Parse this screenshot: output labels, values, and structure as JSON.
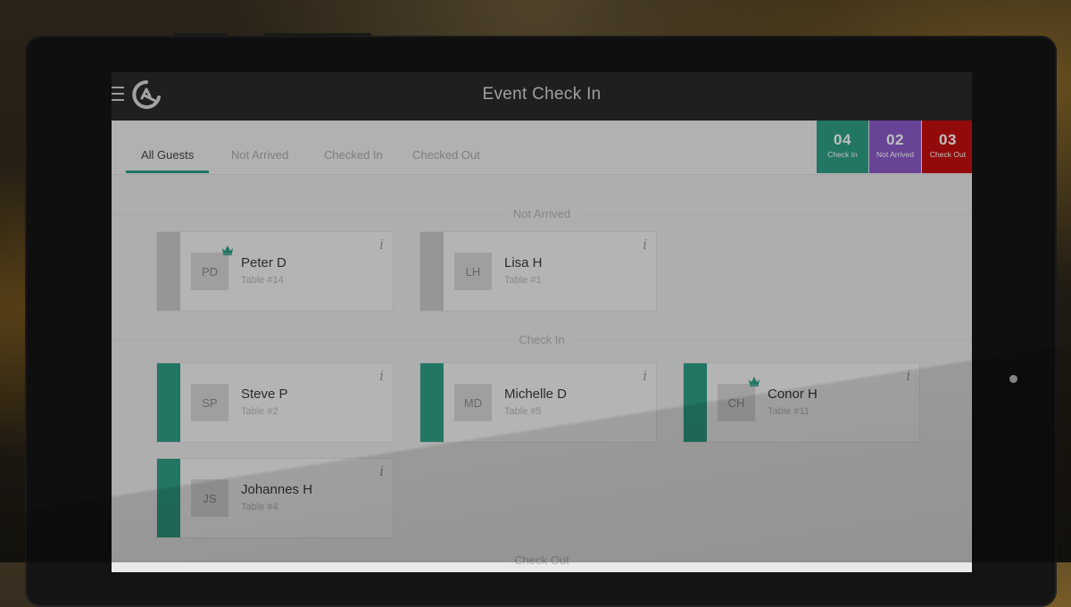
{
  "app": {
    "title": "Event Check In"
  },
  "tabs": [
    {
      "label": "All Guests",
      "active": true
    },
    {
      "label": "Not Arrived",
      "active": false
    },
    {
      "label": "Checked In",
      "active": false
    },
    {
      "label": "Checked Out",
      "active": false
    }
  ],
  "stats": [
    {
      "value": "04",
      "label": "Check In",
      "color": "#2e9e86"
    },
    {
      "value": "02",
      "label": "Not Arrived",
      "color": "#8a5bc9"
    },
    {
      "value": "03",
      "label": "Check Out",
      "color": "#c40e0e"
    }
  ],
  "sections": [
    {
      "label": "Not Arrived",
      "strip_color": "#c9c9c9",
      "guests": [
        {
          "initials": "PD",
          "name": "Peter D",
          "table": "Table #14",
          "vip": true
        },
        {
          "initials": "LH",
          "name": "Lisa H",
          "table": "Table #1",
          "vip": false
        }
      ]
    },
    {
      "label": "Check In",
      "strip_color": "#2e9e86",
      "guests": [
        {
          "initials": "SP",
          "name": "Steve P",
          "table": "Table #2",
          "vip": false
        },
        {
          "initials": "MD",
          "name": "Michelle D",
          "table": "Table #5",
          "vip": false
        },
        {
          "initials": "CH",
          "name": "Conor H",
          "table": "Table #11",
          "vip": true
        },
        {
          "initials": "JS",
          "name": "Johannes H",
          "table": "Table #4",
          "vip": false
        }
      ]
    },
    {
      "label": "Check Out"
    }
  ],
  "icons": {
    "menu": "hamburger-menu-icon",
    "logo": "app-logo-icon",
    "info": "info-icon",
    "vip": "crown-icon"
  },
  "colors": {
    "accent": "#2e9e86",
    "topbar": "#2a2a2a"
  }
}
